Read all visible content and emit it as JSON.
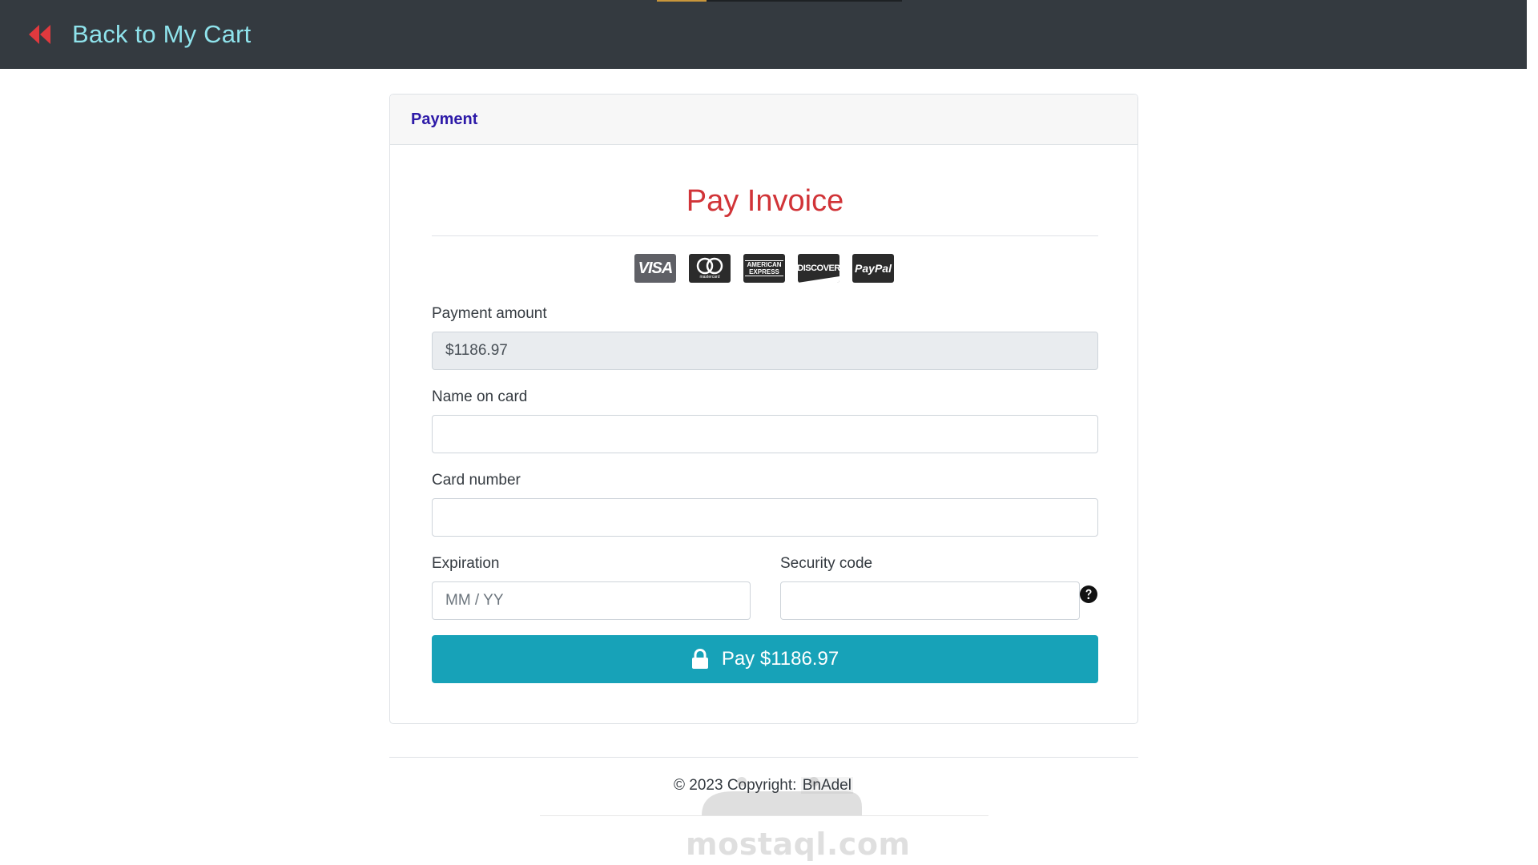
{
  "navbar": {
    "back_label": "Back to My Cart"
  },
  "card": {
    "header_title": "Payment",
    "title": "Pay Invoice",
    "card_brands": [
      "VISA",
      "mastercard",
      "AMERICAN EXPRESS",
      "DISCOVER",
      "PayPal"
    ],
    "payment_amount": {
      "label": "Payment amount",
      "value": "$1186.97"
    },
    "name_on_card": {
      "label": "Name on card",
      "value": "",
      "placeholder": ""
    },
    "card_number": {
      "label": "Card number",
      "value": "",
      "placeholder": ""
    },
    "expiration": {
      "label": "Expiration",
      "value": "",
      "placeholder": "MM / YY"
    },
    "security_code": {
      "label": "Security code",
      "value": "",
      "placeholder": ""
    },
    "pay_button_label": "Pay $1186.97"
  },
  "footer": {
    "copyright_prefix": "© 2023 Copyright:",
    "brand": "BnAdel"
  },
  "watermark": {
    "text": "mostaql.com"
  },
  "colors": {
    "navbar": "#343a40",
    "back_link": "#8fe3ec",
    "back_icon": "#e0393e",
    "header_title": "#2d1aa8",
    "pay_title": "#d13438",
    "pay_button": "#17a2b8"
  }
}
